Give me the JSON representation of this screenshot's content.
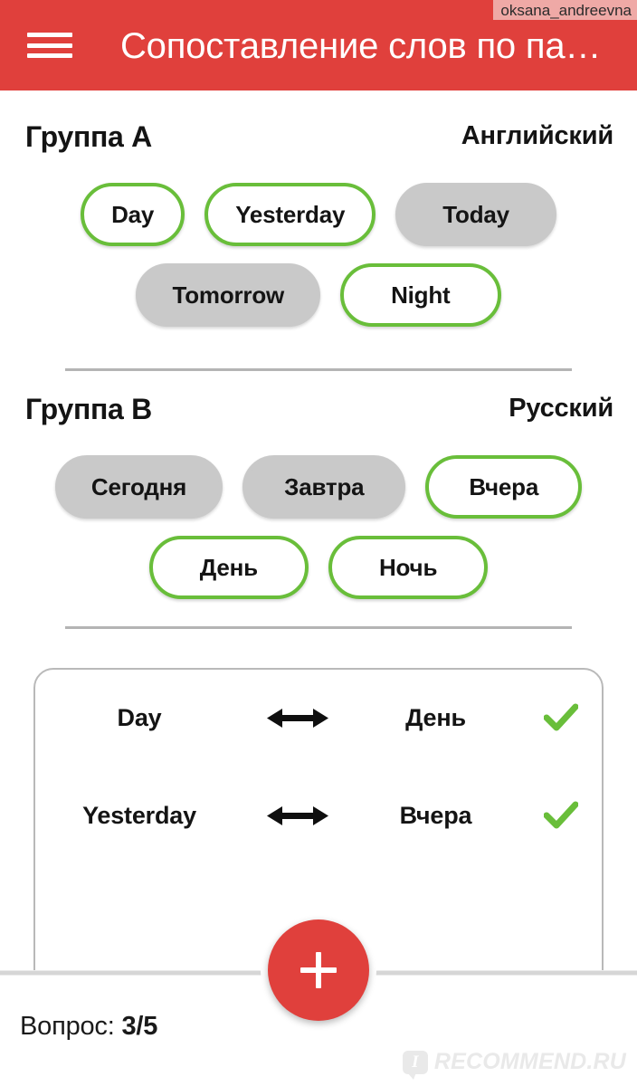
{
  "colors": {
    "brand_red": "#e0403c",
    "accent_green": "#69be3a",
    "chip_gray": "#c9c9c9",
    "text_dark": "#141414"
  },
  "appbar": {
    "title": "Сопоставление слов по па…",
    "menu_icon": "hamburger-menu-icon"
  },
  "user_watermark": "oksana_andreevna",
  "groups": [
    {
      "title": "Группа A",
      "language": "Английский",
      "rows": [
        [
          {
            "label": "Day",
            "state": "outlined"
          },
          {
            "label": "Yesterday",
            "state": "outlined"
          },
          {
            "label": "Today",
            "state": "filled"
          }
        ],
        [
          {
            "label": "Tomorrow",
            "state": "filled"
          },
          {
            "label": "Night",
            "state": "outlined"
          }
        ]
      ]
    },
    {
      "title": "Группа B",
      "language": "Русский",
      "rows": [
        [
          {
            "label": "Сегодня",
            "state": "filled"
          },
          {
            "label": "Завтра",
            "state": "filled"
          },
          {
            "label": "Вчера",
            "state": "outlined"
          }
        ],
        [
          {
            "label": "День",
            "state": "outlined"
          },
          {
            "label": "Ночь",
            "state": "outlined"
          }
        ]
      ]
    }
  ],
  "answers": {
    "pairs": [
      {
        "left": "Day",
        "right": "День",
        "status": "correct",
        "arrow_icon": "double-arrow-icon",
        "status_icon": "check-icon"
      },
      {
        "left": "Yesterday",
        "right": "Вчера",
        "status": "correct",
        "arrow_icon": "double-arrow-icon",
        "status_icon": "check-icon"
      }
    ]
  },
  "fab": {
    "icon": "plus-icon",
    "label": "+"
  },
  "progress": {
    "prefix": "Вопрос:",
    "value": "3/5",
    "current": 3,
    "total": 5
  },
  "site_watermark": {
    "badge": "I",
    "text": "RECOMMEND.RU"
  }
}
